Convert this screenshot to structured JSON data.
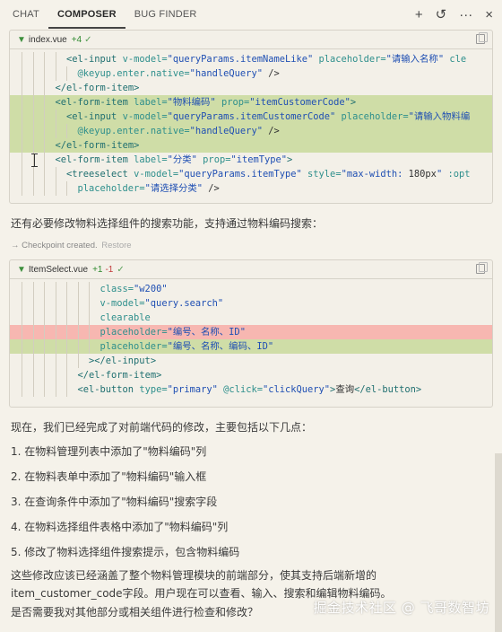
{
  "tabs": [
    "CHAT",
    "COMPOSER",
    "BUG FINDER"
  ],
  "top_icons": {
    "add": "+",
    "history": "↺",
    "more": "···",
    "close": "×"
  },
  "block1": {
    "filename": "index.vue",
    "added": "+4",
    "lines": [
      {
        "type": "normal",
        "indent": 4,
        "tokens": [
          [
            "t",
            "<el-input"
          ],
          [
            "a",
            " v-model="
          ],
          [
            "s",
            "\"queryParams.itemNameLike\""
          ],
          [
            "a",
            " placeholder="
          ],
          [
            "s",
            "\"请输入名称\""
          ],
          [
            "a",
            " cle"
          ]
        ]
      },
      {
        "type": "normal",
        "indent": 5,
        "tokens": [
          [
            "a",
            "@keyup.enter.native="
          ],
          [
            "s",
            "\"handleQuery\""
          ],
          [
            "p",
            " />"
          ]
        ]
      },
      {
        "type": "normal",
        "indent": 3,
        "tokens": [
          [
            "t",
            "</el-form-item>"
          ]
        ]
      },
      {
        "type": "added",
        "indent": 3,
        "tokens": [
          [
            "t",
            "<el-form-item"
          ],
          [
            "a",
            " label="
          ],
          [
            "s",
            "\"物料编码\""
          ],
          [
            "a",
            " prop="
          ],
          [
            "s",
            "\"itemCustomerCode\""
          ],
          [
            "t",
            ">"
          ]
        ]
      },
      {
        "type": "added",
        "indent": 4,
        "tokens": [
          [
            "t",
            "<el-input"
          ],
          [
            "a",
            " v-model="
          ],
          [
            "s",
            "\"queryParams.itemCustomerCode\""
          ],
          [
            "a",
            " placeholder="
          ],
          [
            "s",
            "\"请输入物料编"
          ]
        ]
      },
      {
        "type": "added",
        "indent": 5,
        "tokens": [
          [
            "a",
            "@keyup.enter.native="
          ],
          [
            "s",
            "\"handleQuery\""
          ],
          [
            "p",
            " />"
          ]
        ]
      },
      {
        "type": "added",
        "indent": 3,
        "tokens": [
          [
            "t",
            "</el-form-item>"
          ]
        ]
      },
      {
        "type": "normal",
        "indent": 3,
        "tokens": [
          [
            "t",
            "<el-form-item"
          ],
          [
            "a",
            " label="
          ],
          [
            "s",
            "\"分类\""
          ],
          [
            "a",
            " prop="
          ],
          [
            "s",
            "\"itemType\""
          ],
          [
            "t",
            ">"
          ]
        ]
      },
      {
        "type": "normal",
        "indent": 4,
        "tokens": [
          [
            "t",
            "<treeselect"
          ],
          [
            "a",
            " v-model="
          ],
          [
            "s",
            "\"queryParams.itemType\""
          ],
          [
            "a",
            " style="
          ],
          [
            "s",
            "\"max-width: "
          ],
          [
            "p",
            "180px"
          ],
          [
            "s",
            "\""
          ],
          [
            "a",
            " :opt"
          ]
        ]
      },
      {
        "type": "normal",
        "indent": 5,
        "tokens": [
          [
            "a",
            "placeholder="
          ],
          [
            "s",
            "\"请选择分类\""
          ],
          [
            "p",
            " />"
          ]
        ]
      }
    ]
  },
  "message1": "还有必要修改物料选择组件的搜索功能，支持通过物料编码搜索：",
  "checkpoint": {
    "text": "Checkpoint created.",
    "restore": "Restore"
  },
  "block2": {
    "filename": "ItemSelect.vue",
    "added": "+1",
    "removed": "-1",
    "lines": [
      {
        "type": "normal",
        "indent": 7,
        "tokens": [
          [
            "a",
            "class="
          ],
          [
            "s",
            "\"w200\""
          ]
        ]
      },
      {
        "type": "normal",
        "indent": 7,
        "tokens": [
          [
            "a",
            "v-model="
          ],
          [
            "s",
            "\"query.search\""
          ]
        ]
      },
      {
        "type": "normal",
        "indent": 7,
        "tokens": [
          [
            "a",
            "clearable"
          ]
        ]
      },
      {
        "type": "removed",
        "indent": 7,
        "tokens": [
          [
            "a",
            "placeholder="
          ],
          [
            "s",
            "\"编号、名称、ID\""
          ]
        ]
      },
      {
        "type": "added",
        "indent": 7,
        "tokens": [
          [
            "a",
            "placeholder="
          ],
          [
            "s",
            "\"编号、名称、编码、ID\""
          ]
        ]
      },
      {
        "type": "normal",
        "indent": 6,
        "tokens": [
          [
            "t",
            "></el-input>"
          ]
        ]
      },
      {
        "type": "normal",
        "indent": 5,
        "tokens": [
          [
            "t",
            "</el-form-item>"
          ]
        ]
      },
      {
        "type": "normal",
        "indent": 5,
        "tokens": [
          [
            "t",
            "<el-button"
          ],
          [
            "a",
            " type="
          ],
          [
            "s",
            "\"primary\""
          ],
          [
            "a",
            " @click="
          ],
          [
            "s",
            "\"clickQuery\""
          ],
          [
            "t",
            ">"
          ],
          [
            "p",
            "查询"
          ],
          [
            "t",
            "</el-button>"
          ]
        ]
      }
    ]
  },
  "summary": {
    "intro": "现在，我们已经完成了对前端代码的修改，主要包括以下几点：",
    "items": [
      "1. 在物料管理列表中添加了\"物料编码\"列",
      "2. 在物料表单中添加了\"物料编码\"输入框",
      "3. 在查询条件中添加了\"物料编码\"搜索字段",
      "4. 在物料选择组件表格中添加了\"物料编码\"列",
      "5. 修改了物料选择组件搜索提示，包含物料编码"
    ],
    "p1": "这些修改应该已经涵盖了整个物料管理模块的前端部分，使其支持后端新增的",
    "p2": "item_customer_code字段。用户现在可以查看、输入、搜索和编辑物料编码。",
    "p3": "是否需要我对其他部分或相关组件进行检查和修改？"
  },
  "watermark": "掘金技术社区 @ 飞哥数智坊",
  "colors": {
    "added_line": "#cfdda7",
    "removed_line": "#f7b7b1",
    "tag": "#1f6f70",
    "attr": "#2e8f8c",
    "string": "#1f4fb3"
  }
}
